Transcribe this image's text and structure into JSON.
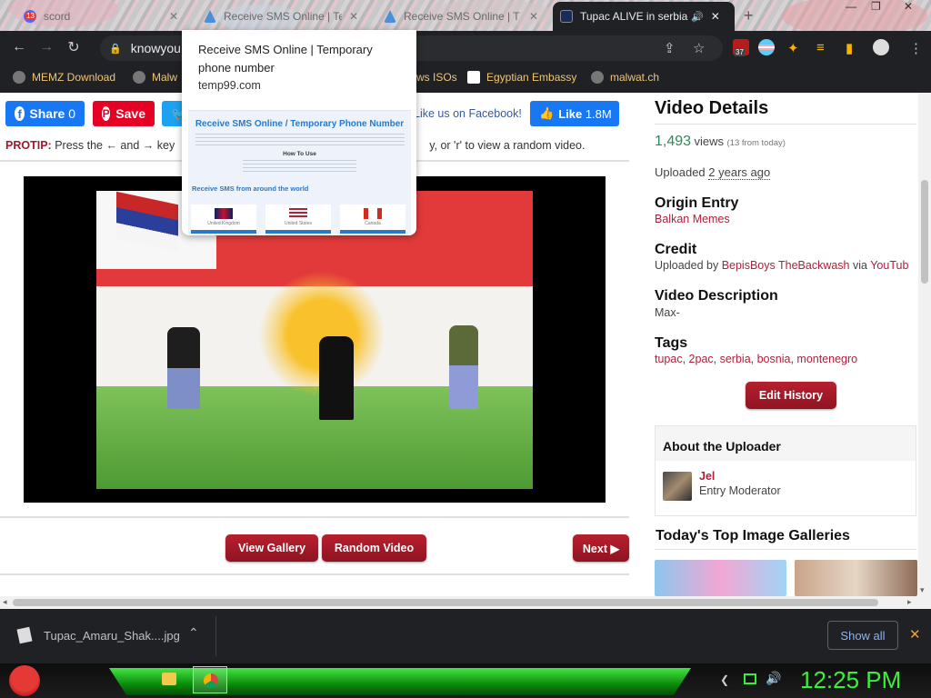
{
  "browser": {
    "tabs": [
      {
        "title": "scord",
        "badge": "13",
        "active": false
      },
      {
        "title": "Receive SMS Online | Te",
        "active": false
      },
      {
        "title": "Receive SMS Online | T",
        "active": false
      },
      {
        "title": "Tupac ALIVE in serbia",
        "active": true
      }
    ],
    "new_tab": "+",
    "url": "knowyou",
    "extension_badge": "37",
    "bookmarks": [
      "MEMZ Download",
      "Malw",
      "ws ISOs",
      "Egyptian Embassy",
      "malwat.ch"
    ]
  },
  "hover_card": {
    "title": "Receive SMS Online | Temporary phone number",
    "domain": "temp99.com",
    "preview_heading": "Receive SMS Online / Temporary Phone Number",
    "preview_how_to": "How To Use",
    "preview_section": "Receive SMS from around the world",
    "countries": [
      "United Kingdom",
      "United States",
      "Canada"
    ]
  },
  "page": {
    "share": {
      "facebook": "Share",
      "facebook_count": "0",
      "pinterest": "Save"
    },
    "fb_like_text": "Like us on Facebook!",
    "fb_like_button": "Like",
    "fb_like_count": "1.8M",
    "protip_label": "PROTIP:",
    "protip_text_a": "Press the ← and → key",
    "protip_text_b": "y, or 'r' to view a random video.",
    "buttons": {
      "gallery": "View Gallery",
      "random": "Random Video",
      "next": "Next ▶"
    }
  },
  "sidebar": {
    "title": "Video Details",
    "views_count": "1,493",
    "views_label": "views",
    "views_today": "(13 from today)",
    "uploaded_label": "Uploaded",
    "uploaded_ago": "2 years ago",
    "origin_heading": "Origin Entry",
    "origin_value": "Balkan Memes",
    "credit_heading": "Credit",
    "credit_prefix": "Uploaded by",
    "credit_user": "BepisBoys TheBackwash",
    "credit_via": "via",
    "credit_source": "YouTub",
    "desc_heading": "Video Description",
    "desc_value": "Max-",
    "tags_heading": "Tags",
    "tags": [
      "tupac",
      "2pac",
      "serbia",
      "bosnia",
      "montenegro"
    ],
    "edit_history": "Edit History",
    "about_heading": "About the Uploader",
    "uploader_name": "Jel",
    "uploader_role": "Entry Moderator",
    "galleries_heading": "Today's Top Image Galleries"
  },
  "download_shelf": {
    "file": "Tupac_Amaru_Shak....jpg",
    "show_all": "Show all",
    "close": "✕"
  },
  "taskbar": {
    "clock": "12:25 PM"
  }
}
